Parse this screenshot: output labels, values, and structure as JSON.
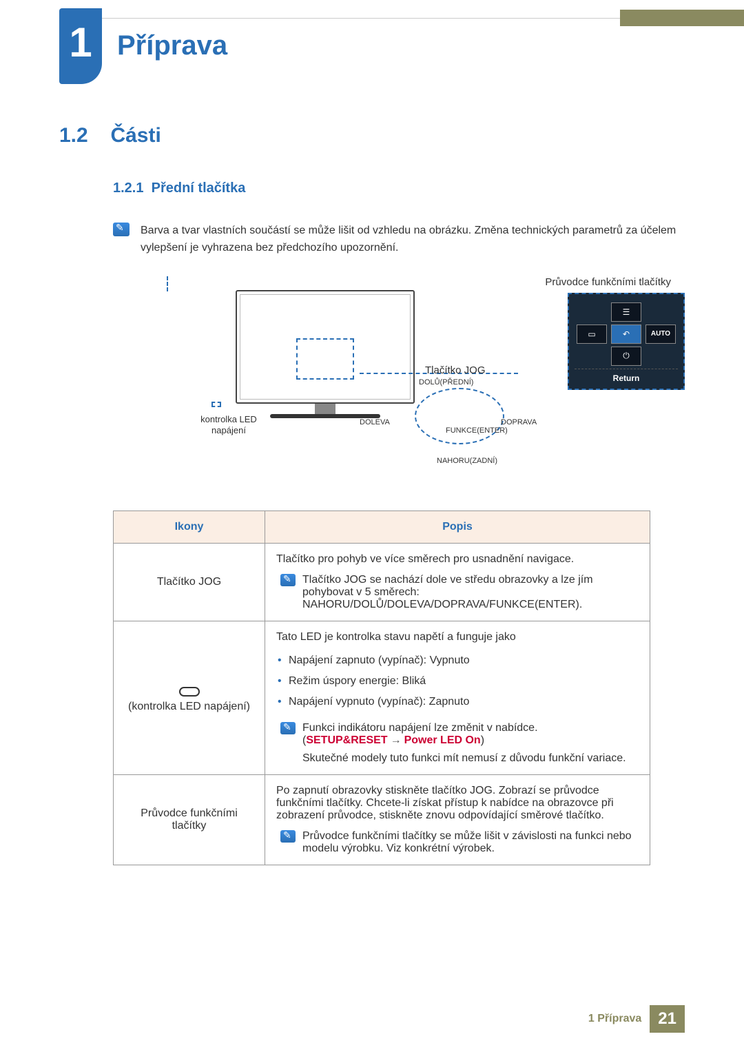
{
  "chapter": {
    "number": "1",
    "title": "Příprava"
  },
  "section": {
    "number": "1.2",
    "title": "Části"
  },
  "subsection": {
    "number": "1.2.1",
    "title": "Přední tlačítka"
  },
  "note_top": "Barva a tvar vlastních součástí se může lišit od vzhledu na obrázku. Změna technických parametrů za účelem vylepšení je vyhrazena bez předchozího upozornění.",
  "diagram": {
    "guide_label": "Průvodce funkčními tlačítky",
    "jog_label": "Tlačítko JOG",
    "led_label_line1": "kontrolka LED",
    "led_label_line2": "napájení",
    "directions": {
      "down_front": "DOLŮ(PŘEDNÍ)",
      "left": "DOLEVA",
      "right": "DOPRAVA",
      "enter": "FUNKCE(ENTER)",
      "up_back": "NAHORU(ZADNÍ)"
    },
    "guide_panel": {
      "auto": "AUTO",
      "return": "Return"
    }
  },
  "table": {
    "header_icons": "Ikony",
    "header_desc": "Popis",
    "rows": [
      {
        "icon_label": "Tlačítko JOG",
        "desc_main": "Tlačítko pro pohyb ve více směrech pro usnadnění navigace.",
        "note": "Tlačítko JOG se nachází dole ve středu obrazovky a lze jím pohybovat v 5 směrech: NAHORU/DOLŮ/DOLEVA/DOPRAVA/FUNKCE(ENTER)."
      },
      {
        "icon_label": "(kontrolka LED napájení)",
        "desc_main": "Tato LED je kontrolka stavu napětí a funguje jako",
        "bullets": [
          "Napájení zapnuto (vypínač): Vypnuto",
          "Režim úspory energie: Bliká",
          "Napájení vypnuto (vypínač): Zapnuto"
        ],
        "note_line1": "Funkci indikátoru napájení lze změnit v nabídce.",
        "menu_path_left": "SETUP&RESET",
        "menu_path_right": "Power LED On",
        "note_line2": "Skutečné modely tuto funkci mít nemusí z důvodu funkční variace."
      },
      {
        "icon_label": "Průvodce funkčními tlačítky",
        "desc_main": "Po zapnutí obrazovky stiskněte tlačítko JOG. Zobrazí se průvodce funkčními tlačítky. Chcete-li získat přístup k nabídce na obrazovce při zobrazení průvodce, stiskněte znovu odpovídající směrové tlačítko.",
        "note": "Průvodce funkčními tlačítky se může lišit v závislosti na funkci nebo modelu výrobku. Viz konkrétní výrobek."
      }
    ]
  },
  "footer": {
    "text": "1 Příprava",
    "page": "21"
  }
}
